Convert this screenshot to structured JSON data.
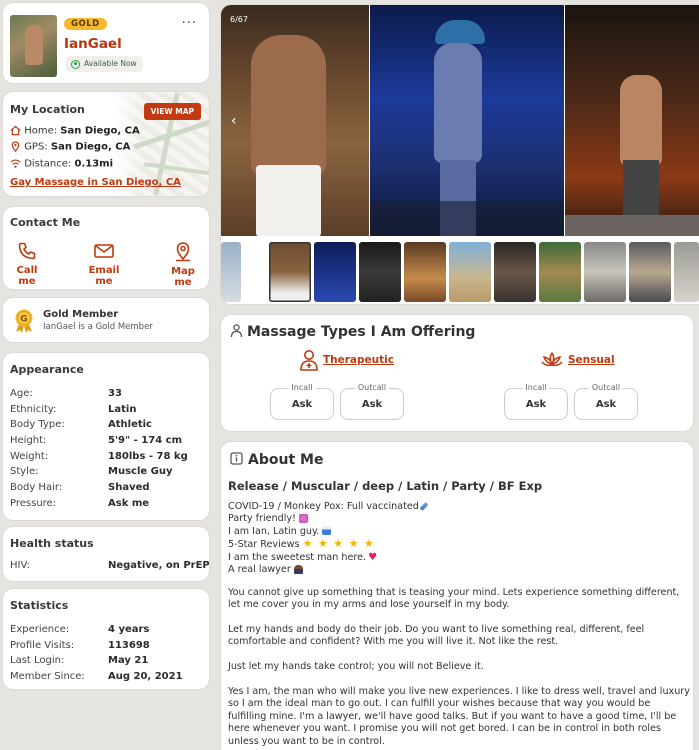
{
  "profile": {
    "badge": "GOLD",
    "username": "IanGael",
    "availability": "Available Now",
    "menu_glyph": "···"
  },
  "location": {
    "title": "My Location",
    "view_map": "VIEW MAP",
    "home_label": "Home:",
    "home_value": "San Diego, CA",
    "gps_label": "GPS:",
    "gps_value": "San Diego, CA",
    "distance_label": "Distance:",
    "distance_value": "0.13mi",
    "link": "Gay Massage in San Diego, CA"
  },
  "contact": {
    "title": "Contact Me",
    "call": "Call me",
    "email": "Email me",
    "map": "Map me"
  },
  "gold_member": {
    "title": "Gold Member",
    "subtitle": "IanGael is a Gold Member",
    "icon_letter": "G"
  },
  "appearance": {
    "title": "Appearance",
    "rows": [
      {
        "k": "Age:",
        "v": "33"
      },
      {
        "k": "Ethnicity:",
        "v": "Latin"
      },
      {
        "k": "Body Type:",
        "v": "Athletic"
      },
      {
        "k": "Height:",
        "v": "5'9\" - 174 cm"
      },
      {
        "k": "Weight:",
        "v": "180lbs - 78 kg"
      },
      {
        "k": "Style:",
        "v": "Muscle Guy"
      },
      {
        "k": "Body Hair:",
        "v": "Shaved"
      },
      {
        "k": "Pressure:",
        "v": "Ask me"
      }
    ]
  },
  "health": {
    "title": "Health status",
    "rows": [
      {
        "k": "HIV:",
        "v": "Negative, on PrEP"
      }
    ]
  },
  "statistics": {
    "title": "Statistics",
    "rows": [
      {
        "k": "Experience:",
        "v": "4 years"
      },
      {
        "k": "Profile Visits:",
        "v": "113698"
      },
      {
        "k": "Last Login:",
        "v": "May 21"
      },
      {
        "k": "Member Since:",
        "v": "Aug 20, 2021"
      }
    ]
  },
  "gallery": {
    "counter": "6/67",
    "prev_glyph": "‹",
    "thumb_prev_glyph": "‹"
  },
  "massage": {
    "title": "Massage Types I Am Offering",
    "types": [
      {
        "name": "Therapeutic",
        "incall_label": "Incall",
        "incall": "Ask",
        "outcall_label": "Outcall",
        "outcall": "Ask"
      },
      {
        "name": "Sensual",
        "incall_label": "Incall",
        "incall": "Ask",
        "outcall_label": "Outcall",
        "outcall": "Ask"
      }
    ]
  },
  "about": {
    "title": "About Me",
    "headline": "Release / Muscular / deep / Latin / Party / BF Exp",
    "lines": [
      "COVID-19 / Monkey Pox: Full vaccinated",
      "Party friendly!",
      "I am Ian, Latin guy.",
      "5-Star Reviews",
      "I am the sweetest man here.",
      "A real lawyer"
    ],
    "stars": "★ ★ ★ ★ ★",
    "paragraphs": [
      "You cannot give up something that is teasing your mind. Lets experience something different, let me cover you in my arms and lose yourself in my body.",
      "Let my hands and body do their job. Do you want to live something real, different, feel comfortable and confident? With me you will live it. Not like the rest.",
      "Just let my hands take control; you will not Believe it.",
      "Yes I am, the man who will make you live new experiences. I like to dress well, travel and luxury so I am the ideal man to go out. I can fulfill your wishes because that way you would be fulfilling mine. I'm a lawyer, we'll have good talks. But if you want to have a good time, I'll be here whenever you want. I promise you will not get bored. I can be in control in both roles unless you want to be in control."
    ]
  },
  "colors": {
    "accent": "#c0380e",
    "gold": "#f5b82e",
    "available": "#26a345",
    "background": "#e6e4e1"
  }
}
